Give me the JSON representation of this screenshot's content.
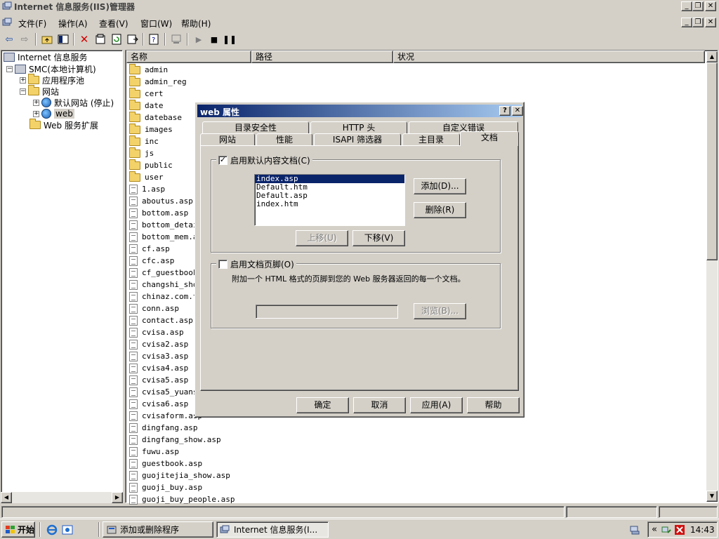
{
  "window": {
    "title": "Internet 信息服务(IIS)管理器"
  },
  "menu": [
    "文件(F)",
    "操作(A)",
    "查看(V)",
    "窗口(W)",
    "帮助(H)"
  ],
  "tree": {
    "root": "Internet 信息服务",
    "computer": "SMC(本地计算机)",
    "app_pools": "应用程序池",
    "websites": "网站",
    "default_site": "默认网站 (停止)",
    "web_site": "web",
    "web_ext": "Web 服务扩展"
  },
  "list": {
    "columns": [
      "名称",
      "路径",
      "状况"
    ],
    "items": [
      {
        "name": "admin",
        "type": "folder"
      },
      {
        "name": "admin_reg",
        "type": "folder"
      },
      {
        "name": "cert",
        "type": "folder"
      },
      {
        "name": "date",
        "type": "folder"
      },
      {
        "name": "datebase",
        "type": "folder"
      },
      {
        "name": "images",
        "type": "folder"
      },
      {
        "name": "inc",
        "type": "folder"
      },
      {
        "name": "js",
        "type": "folder"
      },
      {
        "name": "public",
        "type": "folder"
      },
      {
        "name": "user",
        "type": "folder"
      },
      {
        "name": "1.asp",
        "type": "file"
      },
      {
        "name": "aboutus.asp",
        "type": "file"
      },
      {
        "name": "bottom.asp",
        "type": "file"
      },
      {
        "name": "bottom_detail",
        "type": "file"
      },
      {
        "name": "bottom_mem.as",
        "type": "file"
      },
      {
        "name": "cf.asp",
        "type": "file"
      },
      {
        "name": "cfc.asp",
        "type": "file"
      },
      {
        "name": "cf_guestbook.",
        "type": "file"
      },
      {
        "name": "changshi_show",
        "type": "file"
      },
      {
        "name": "chinaz.com.tx",
        "type": "file"
      },
      {
        "name": "conn.asp",
        "type": "file"
      },
      {
        "name": "contact.asp",
        "type": "file"
      },
      {
        "name": "cvisa.asp",
        "type": "file"
      },
      {
        "name": "cvisa2.asp",
        "type": "file"
      },
      {
        "name": "cvisa3.asp",
        "type": "file"
      },
      {
        "name": "cvisa4.asp",
        "type": "file"
      },
      {
        "name": "cvisa5.asp",
        "type": "file"
      },
      {
        "name": "cvisa5_yuansh",
        "type": "file"
      },
      {
        "name": "cvisa6.asp",
        "type": "file"
      },
      {
        "name": "cvisaform.asp",
        "type": "file"
      },
      {
        "name": "dingfang.asp",
        "type": "file"
      },
      {
        "name": "dingfang_show.asp",
        "type": "file"
      },
      {
        "name": "fuwu.asp",
        "type": "file"
      },
      {
        "name": "guestbook.asp",
        "type": "file"
      },
      {
        "name": "guojitejia_show.asp",
        "type": "file"
      },
      {
        "name": "guoji_buy.asp",
        "type": "file"
      },
      {
        "name": "guoji_buy_people.asp",
        "type": "file"
      }
    ]
  },
  "dialog": {
    "title": "web 属性",
    "help_glyph": "?",
    "tabs_row1": [
      "目录安全性",
      "HTTP 头",
      "自定义错误"
    ],
    "tabs_row2": [
      "网站",
      "性能",
      "ISAPI 筛选器",
      "主目录",
      "文档"
    ],
    "enable_default_doc": "启用默认内容文档(C)",
    "default_docs": [
      "index.asp",
      "Default.htm",
      "Default.asp",
      "index.htm"
    ],
    "add_btn": "添加(D)...",
    "remove_btn": "删除(R)",
    "move_up_btn": "上移(U)",
    "move_down_btn": "下移(V)",
    "enable_footer": "启用文档页脚(O)",
    "footer_desc": "附加一个 HTML 格式的页脚到您的 Web 服务器返回的每一个文档。",
    "browse_btn": "浏览(B)...",
    "ok": "确定",
    "cancel": "取消",
    "apply": "应用(A)",
    "help": "帮助"
  },
  "taskbar": {
    "start": "开始",
    "task1": "添加或删除程序",
    "task2": "Internet 信息服务(I...",
    "tray_chevron": "«",
    "clock": "14:43"
  }
}
